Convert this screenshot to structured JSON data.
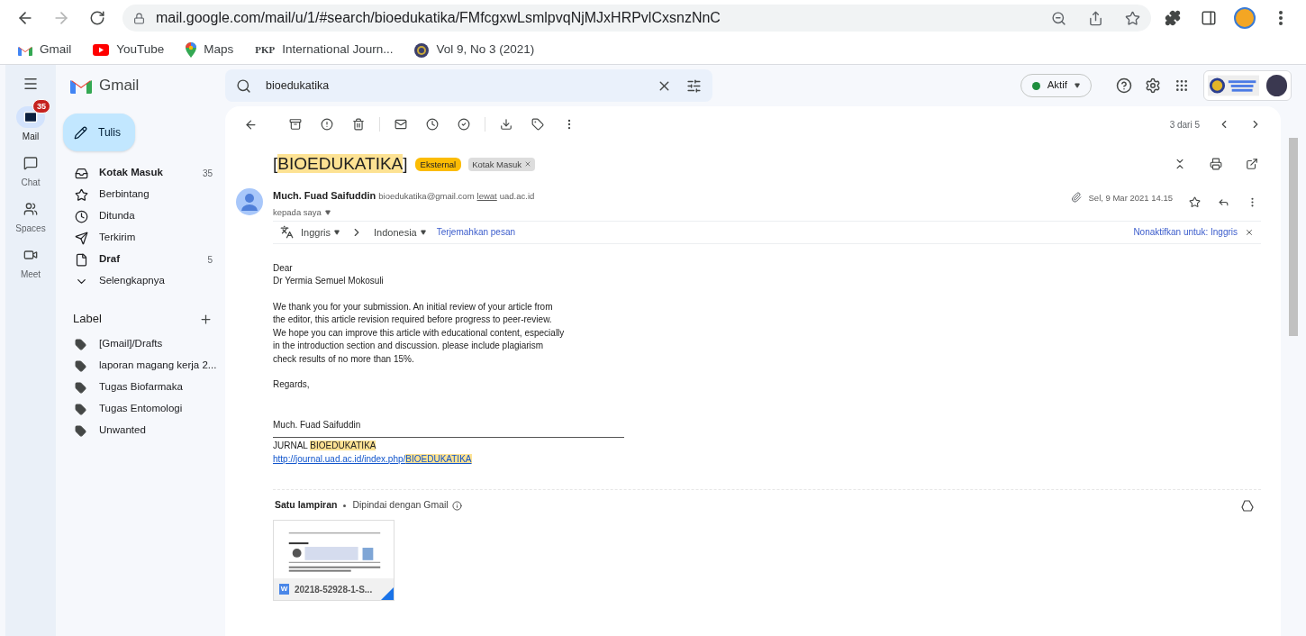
{
  "browser": {
    "url": "mail.google.com/mail/u/1/#search/bioedukatika/FMfcgxwLsmlpvqNjMJxHRPvlCxsnzNnC",
    "bookmarks": [
      {
        "kind": "gmail",
        "label": "Gmail"
      },
      {
        "kind": "youtube",
        "label": "YouTube"
      },
      {
        "kind": "maps",
        "label": "Maps"
      },
      {
        "kind": "pkp",
        "badge": "PKP",
        "label": "International Journ..."
      },
      {
        "kind": "seal",
        "label": "Vol 9, No 3 (2021)"
      }
    ]
  },
  "app": {
    "name": "Gmail",
    "search": {
      "value": "bioedukatika"
    },
    "status": "Aktif"
  },
  "rail": [
    {
      "label": "Mail",
      "kind": "mail",
      "selected": true,
      "badge": "35"
    },
    {
      "label": "Chat",
      "kind": "chat",
      "selected": false
    },
    {
      "label": "Spaces",
      "kind": "spaces",
      "selected": false
    },
    {
      "label": "Meet",
      "kind": "meet",
      "selected": false
    }
  ],
  "compose": "Tulis",
  "folders": [
    {
      "kind": "inbox",
      "label": "Kotak Masuk",
      "count": "35",
      "bold": true
    },
    {
      "kind": "star",
      "label": "Berbintang",
      "bold": false
    },
    {
      "kind": "clock",
      "label": "Ditunda",
      "bold": false
    },
    {
      "kind": "send",
      "label": "Terkirim",
      "bold": false
    },
    {
      "kind": "draft",
      "label": "Draf",
      "count": "5",
      "bold": true
    },
    {
      "kind": "more",
      "label": "Selengkapnya",
      "bold": false
    }
  ],
  "labels_title": "Label",
  "labels": [
    "[Gmail]/Drafts",
    "laporan magang kerja 2...",
    "Tugas Biofarmaka",
    "Tugas Entomologi",
    "Unwanted"
  ],
  "pager": "3 dari 5",
  "subject": {
    "before": "[",
    "highlight": "BIOEDUKATIKA",
    "after": "]"
  },
  "tags": [
    {
      "label": "Eksternal",
      "kind": "external"
    },
    {
      "label": "Kotak Masuk",
      "kind": "folder"
    }
  ],
  "sender": {
    "name": "Much. Fuad Saifuddin",
    "email": "bioedukatika@gmail.com",
    "via": "lewat",
    "domain": "uad.ac.id",
    "to": "kepada saya",
    "date": "Sel, 9 Mar 2021 14.15"
  },
  "translate": {
    "from": "Inggris",
    "to": "Indonesia",
    "action": "Terjemahkan pesan",
    "disable": "Nonaktifkan untuk: Inggris"
  },
  "body": [
    "Dear",
    "Dr Yermia Semuel Mokosuli",
    "We thank you for your submission. An initial review of your article from the editor, this article revision required before progress to peer-review. We hope you can improve this article with educational content, especially in the introduction section and discussion. please include plagiarism check results of no more than 15%.",
    "Regards,",
    "Much. Fuad Saifuddin"
  ],
  "signature": {
    "journal": {
      "before": "JURNAL ",
      "highlight": "BIOEDUKATIKA"
    },
    "link": {
      "before": "http://journal.uad.ac.id/index.php/",
      "highlight": "BIOEDUKATIKA"
    }
  },
  "attachments": {
    "title": "Satu lampiran",
    "scan": "Dipindai dengan Gmail",
    "file": {
      "badge": "W",
      "name": "20218-52928-1-S..."
    }
  }
}
